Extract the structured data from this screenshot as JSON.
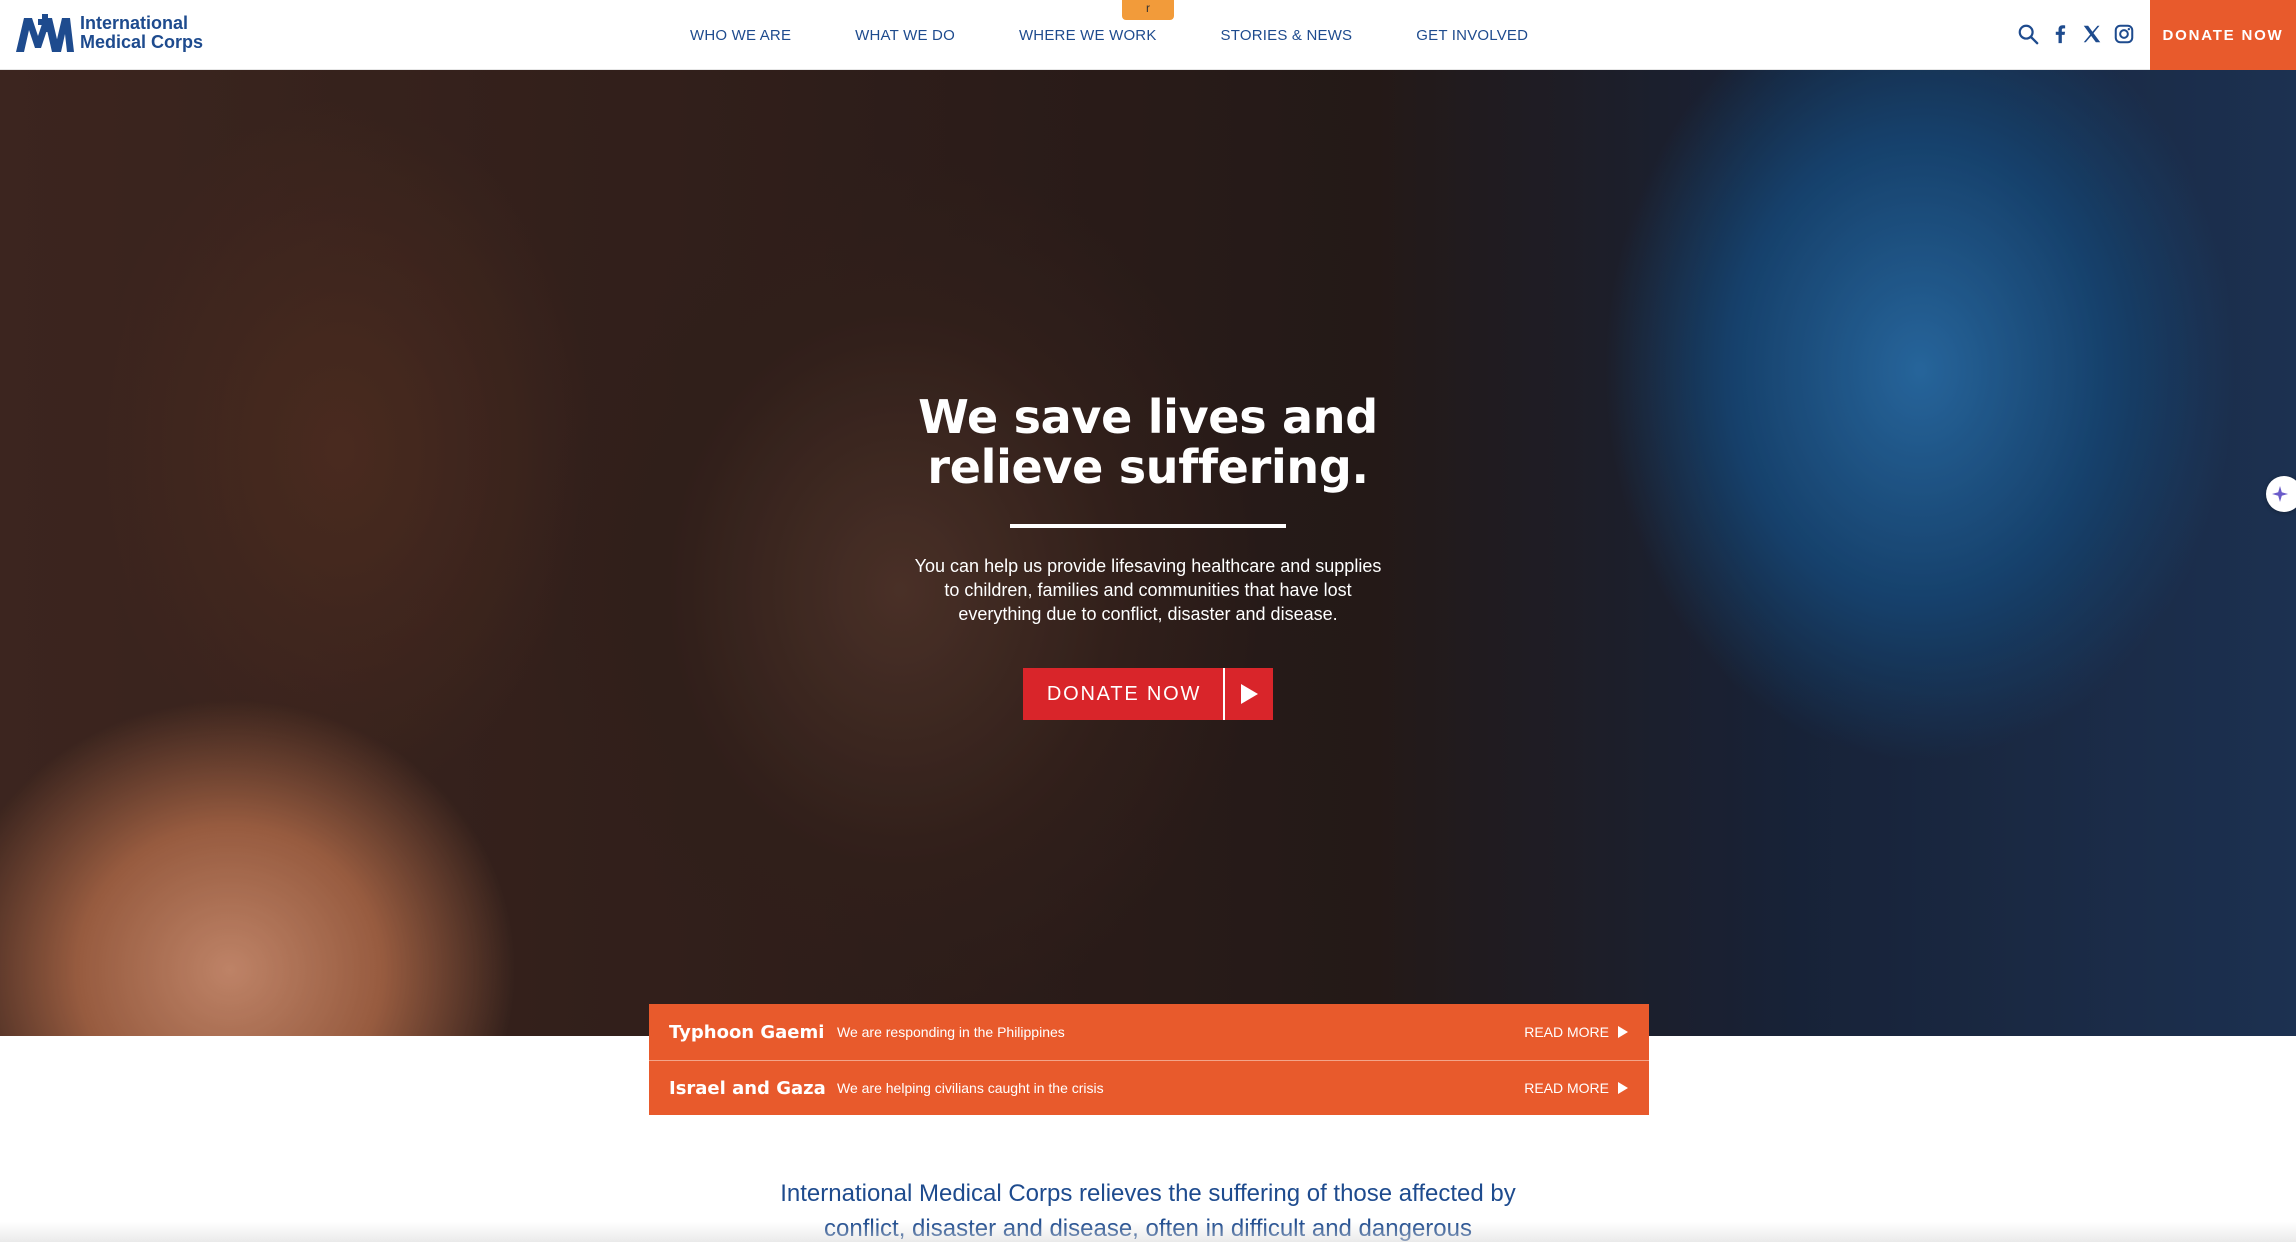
{
  "header": {
    "logo_line1": "International",
    "logo_line2": "Medical Corps",
    "nav": [
      "WHO WE ARE",
      "WHAT WE DO",
      "WHERE WE WORK",
      "STORIES & NEWS",
      "GET INVOLVED"
    ],
    "tab_flag": "r",
    "icons": [
      "search-icon",
      "facebook-icon",
      "x-icon",
      "instagram-icon"
    ],
    "donate_label": "DONATE NOW"
  },
  "hero": {
    "title_line1": "We save lives and",
    "title_line2": "relieve suffering.",
    "text": "You can help us provide lifesaving healthcare and supplies to children, families and communities that have lost everything due to conflict, disaster and disease.",
    "button_label": "DONATE NOW"
  },
  "alerts": [
    {
      "title": "Typhoon Gaemi",
      "description": "We are responding in the Philippines",
      "link": "READ MORE"
    },
    {
      "title": "Israel and Gaza",
      "description": "We are helping civilians caught in the crisis",
      "link": "READ MORE"
    }
  ],
  "mission": {
    "text": "International Medical Corps relieves the suffering of those affected by conflict, disaster and disease, often in difficult and dangerous"
  },
  "colors": {
    "brand_blue": "#1e4b8e",
    "brand_orange": "#e85a2c",
    "donate_red": "#d9252a"
  }
}
